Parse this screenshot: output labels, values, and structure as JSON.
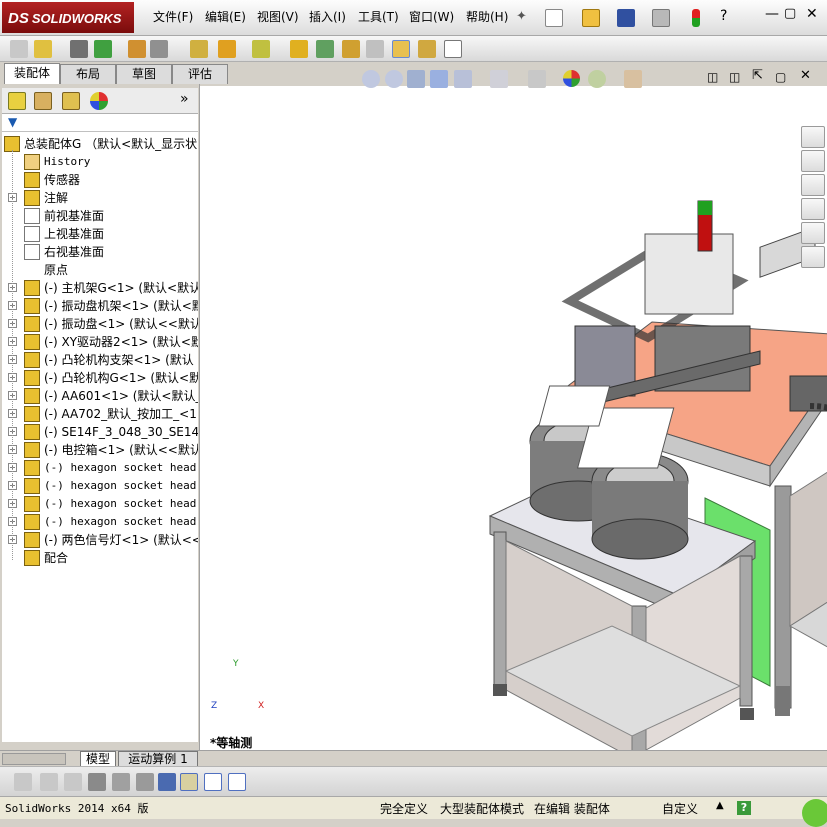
{
  "app": {
    "logo_ds": "DS",
    "logo_text": "SOLIDWORKS"
  },
  "menu": [
    "文件(F)",
    "编辑(E)",
    "视图(V)",
    "插入(I)",
    "工具(T)",
    "窗口(W)",
    "帮助(H)"
  ],
  "tabs": [
    "装配体",
    "布局",
    "草图",
    "评估"
  ],
  "tree": {
    "root": "总装配体G （默认<默认_显示状",
    "items": [
      {
        "label": "History",
        "mono": true,
        "expand": false
      },
      {
        "label": "传感器",
        "mono": false,
        "expand": false
      },
      {
        "label": "注解",
        "mono": false,
        "expand": true
      },
      {
        "label": "前视基准面",
        "mono": false,
        "expand": false
      },
      {
        "label": "上视基准面",
        "mono": false,
        "expand": false
      },
      {
        "label": "右视基准面",
        "mono": false,
        "expand": false
      },
      {
        "label": "原点",
        "mono": false,
        "expand": false
      },
      {
        "label": "(-) 主机架G<1> (默认<默认_",
        "mono": false,
        "expand": true
      },
      {
        "label": "(-) 振动盘机架<1> (默认<默",
        "mono": false,
        "expand": true
      },
      {
        "label": "(-) 振动盘<1> (默认<<默认",
        "mono": false,
        "expand": true
      },
      {
        "label": "(-) XY驱动器2<1> (默认<默",
        "mono": false,
        "expand": true
      },
      {
        "label": "(-) 凸轮机构支架<1> (默认",
        "mono": false,
        "expand": true
      },
      {
        "label": "(-) 凸轮机构G<1> (默认<默",
        "mono": false,
        "expand": true
      },
      {
        "label": "(-) AA601<1> (默认<默认_显",
        "mono": false,
        "expand": true
      },
      {
        "label": "(-) AA702_默认_按加工_<1>",
        "mono": false,
        "expand": true
      },
      {
        "label": "(-) SE14F_3_048_30_SE14F-",
        "mono": false,
        "expand": true
      },
      {
        "label": "(-) 电控箱<1> (默认<<默认",
        "mono": false,
        "expand": true
      },
      {
        "label": "(-) hexagon socket head c",
        "mono": true,
        "expand": true
      },
      {
        "label": "(-) hexagon socket head c",
        "mono": true,
        "expand": true
      },
      {
        "label": "(-) hexagon socket head c",
        "mono": true,
        "expand": true
      },
      {
        "label": "(-) hexagon socket head c",
        "mono": true,
        "expand": true
      },
      {
        "label": "(-) 两色信号灯<1> (默认<<",
        "mono": false,
        "expand": true
      },
      {
        "label": "配合",
        "mono": false,
        "expand": false
      }
    ]
  },
  "viewport": {
    "view_name": "*等轴测"
  },
  "bottom_tabs": [
    "模型",
    "运动算例 1"
  ],
  "status": {
    "app": "SolidWorks 2014 x64 版",
    "defined": "完全定义",
    "mode": "大型装配体模式",
    "editing": "在编辑 装配体",
    "custom": "自定义"
  }
}
